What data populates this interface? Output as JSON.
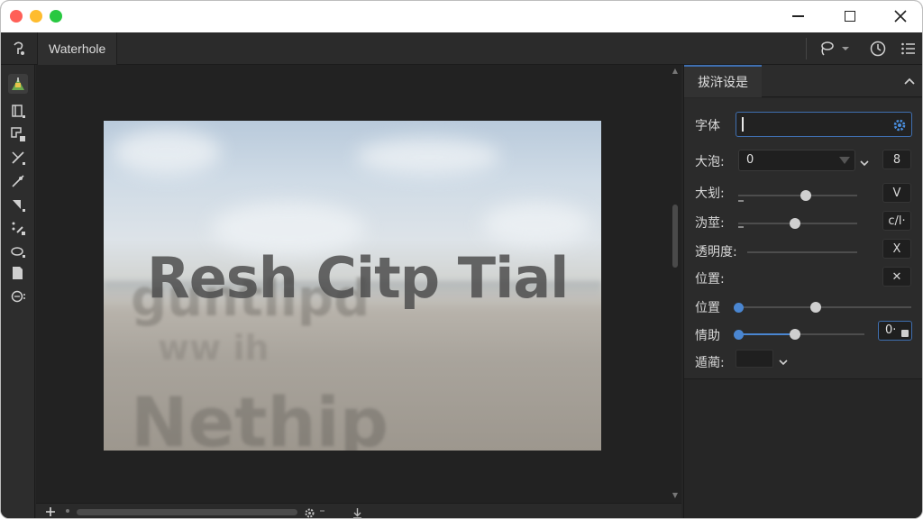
{
  "app": {
    "document_tab": "Waterhole"
  },
  "canvas": {
    "main_text": "Resh Citp Tial",
    "ghost_texts": [
      "guntlipd",
      "Nethip",
      "ww ih"
    ]
  },
  "panel": {
    "tab_label": "拔浒设是",
    "rows": {
      "font": {
        "label": "字体",
        "value": ""
      },
      "size": {
        "label": "大泡:",
        "value": "0",
        "side_value": "8"
      },
      "weight": {
        "label": "大刬:",
        "side_value": "V"
      },
      "blur": {
        "label": "沩莖:",
        "side_value": "c/l·"
      },
      "opacity": {
        "label": "透明度:",
        "side_value": "X"
      },
      "position1": {
        "label": "位置:",
        "side_value": "✕"
      },
      "position2": {
        "label": "位置",
        "slider_value": 0.45
      },
      "emotion": {
        "label": "情助",
        "slider_value": 0.45,
        "num_value": "0·"
      },
      "color": {
        "label": "遁蔺:"
      }
    },
    "sliders": {
      "weight": 0.57,
      "blur": 0.48,
      "opacity": 0.0
    }
  },
  "colors": {
    "accent": "#4a86d1",
    "window_bg": "#262626",
    "panel_bg": "#2b2b2b"
  },
  "icons": [
    "app-lasso-icon",
    "lasso-icon",
    "history-icon",
    "list-icon",
    "gear-icon",
    "plus-icon",
    "download-icon"
  ]
}
